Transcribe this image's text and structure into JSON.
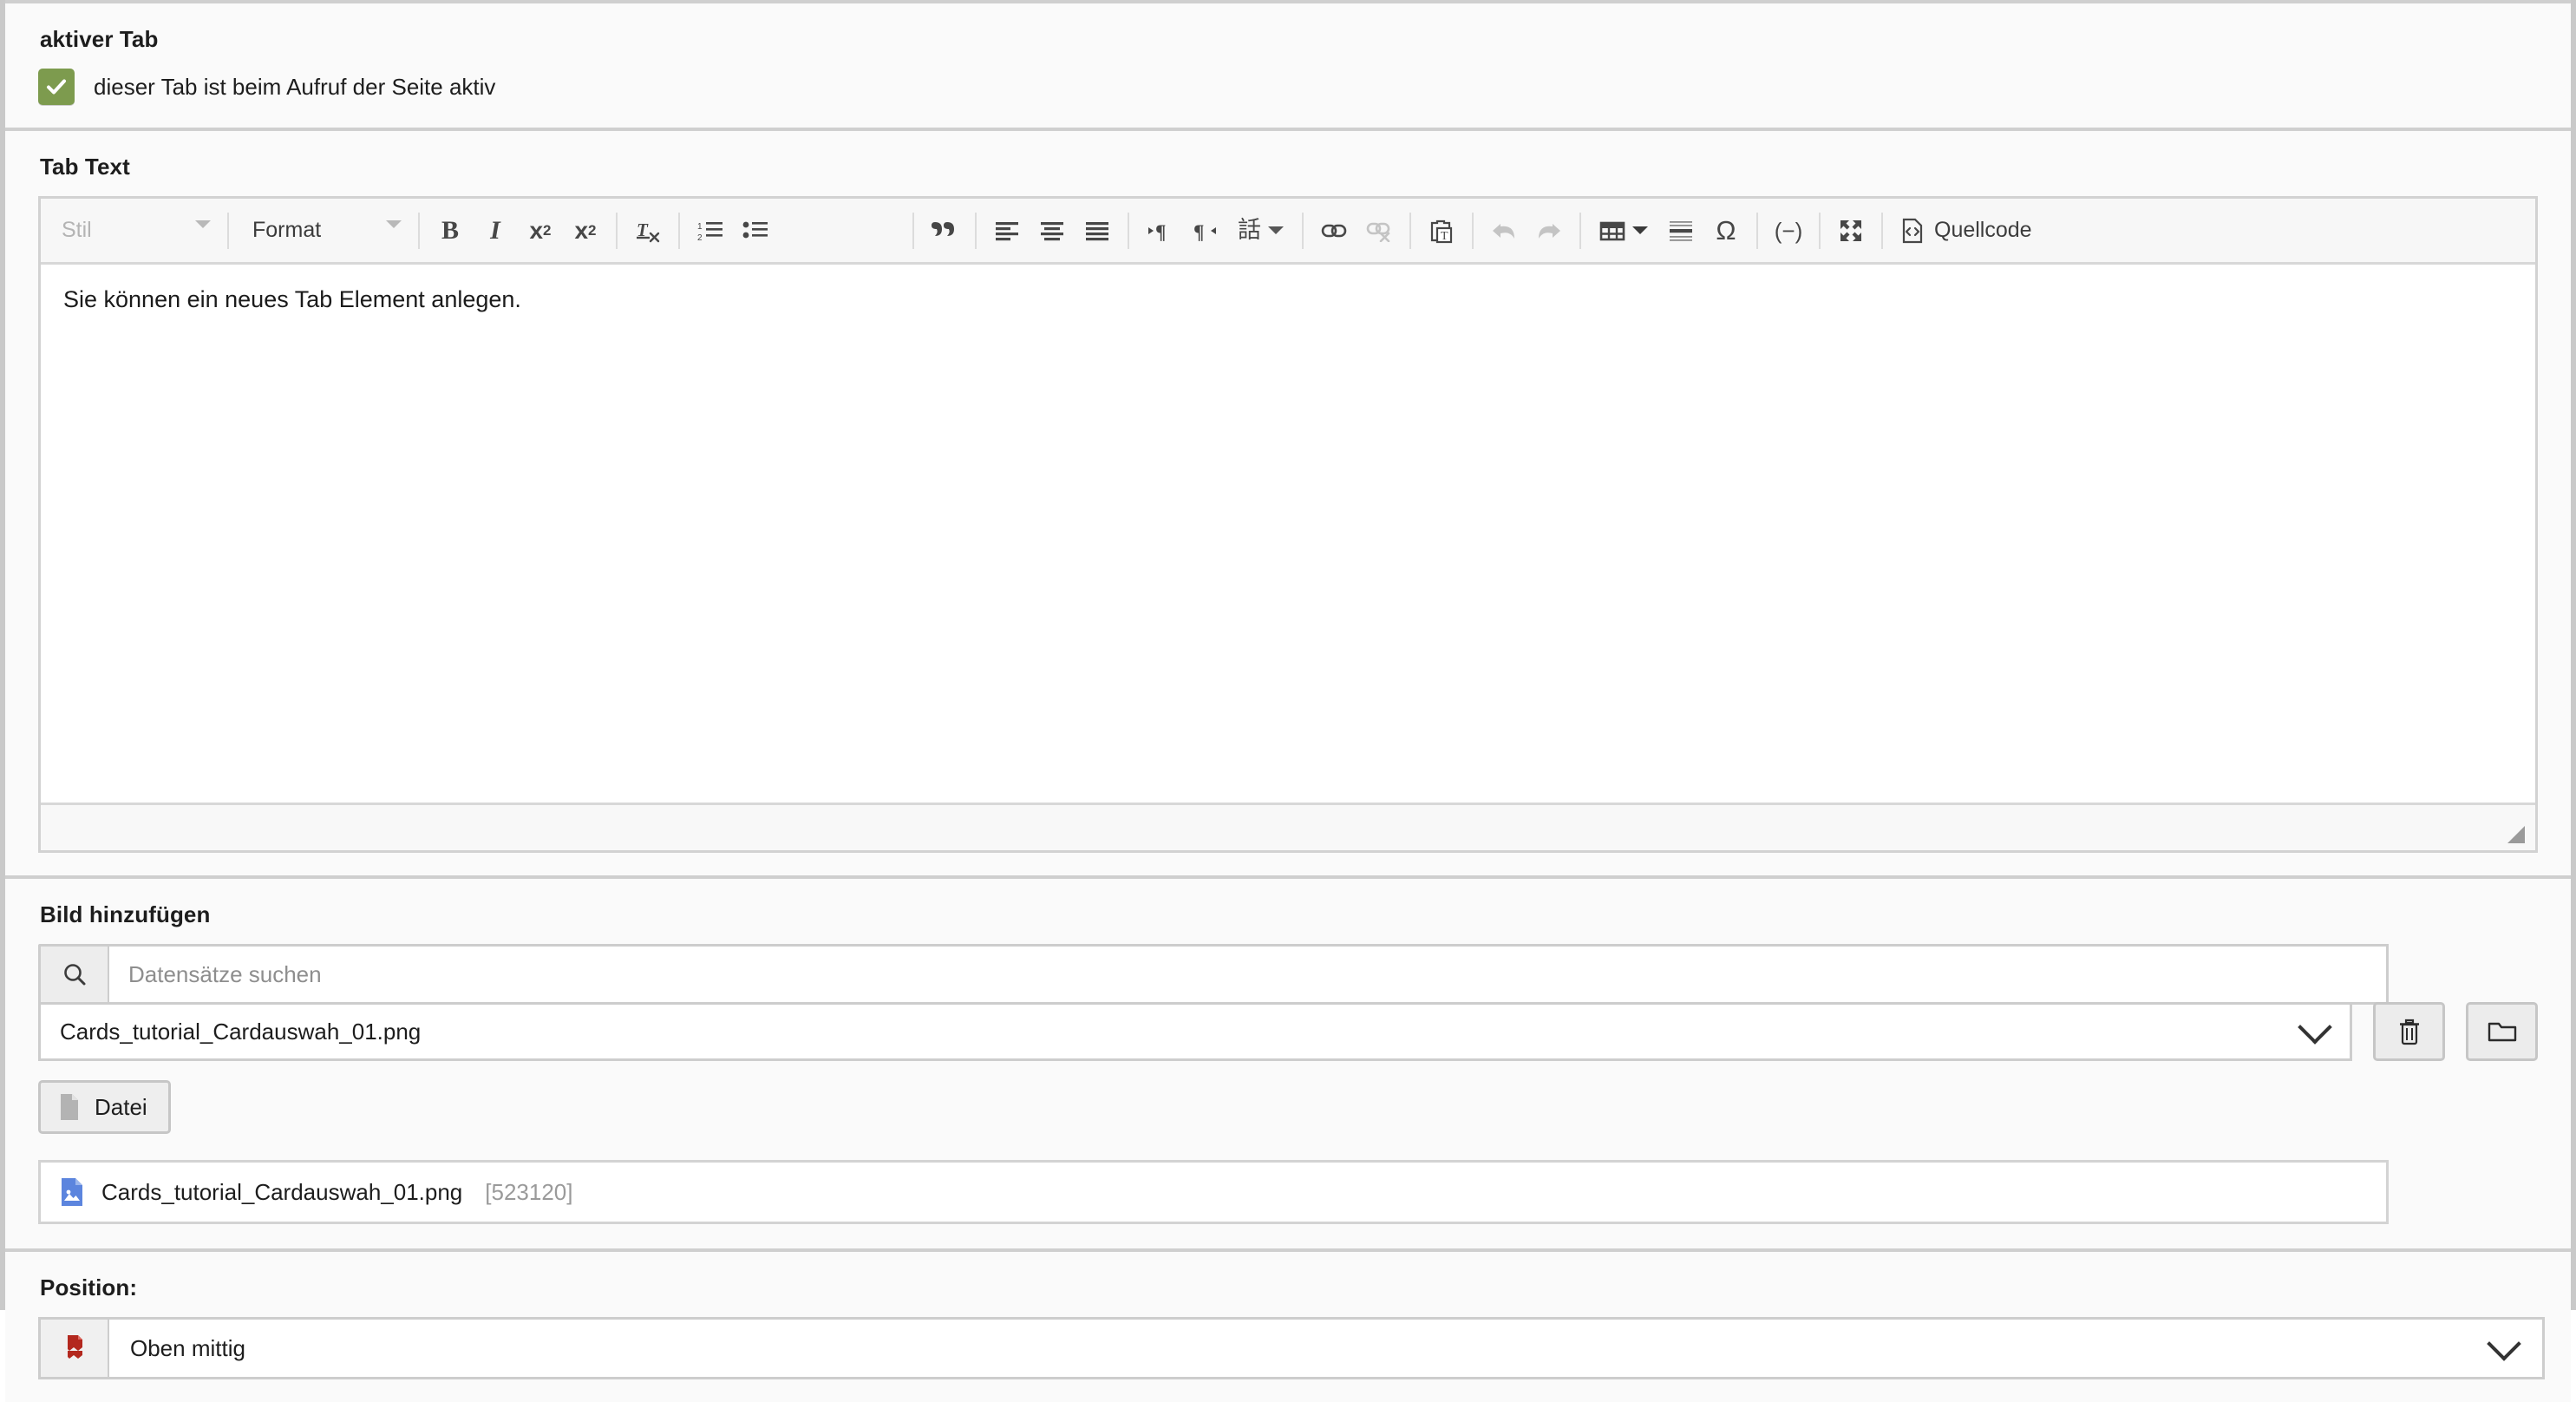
{
  "sections": {
    "active_tab": {
      "legend": "aktiver Tab",
      "checkbox_label": "dieser Tab ist beim Aufruf der Seite aktiv",
      "checkbox_checked": true,
      "checkbox_color": "#7d9b4e"
    },
    "tab_text": {
      "legend": "Tab Text",
      "content": "Sie können ein neues Tab Element anlegen."
    },
    "add_image": {
      "legend": "Bild hinzufügen",
      "search_placeholder": "Datensätze suchen",
      "search_value": "",
      "selected_record": "Cards_tutorial_Cardauswah_01.png",
      "delete_button_title": "Löschen",
      "browse_button_title": "Durchsuchen",
      "file_button_label": "Datei",
      "attached_file": {
        "name": "Cards_tutorial_Cardauswah_01.png",
        "size": "[523120]"
      }
    },
    "position": {
      "legend": "Position:",
      "selected": "Oben mittig"
    }
  },
  "editor": {
    "style_combo": "Stil",
    "format_combo": "Format",
    "source_label": "Quellcode",
    "buttons": [
      {
        "name": "bold-button",
        "title": "Fett"
      },
      {
        "name": "italic-button",
        "title": "Kursiv"
      },
      {
        "name": "subscript-button",
        "title": "Tiefgestellt"
      },
      {
        "name": "superscript-button",
        "title": "Hochgestellt"
      },
      {
        "name": "remove-format-button",
        "title": "Formatierung entfernen"
      },
      {
        "name": "numbered-list-button",
        "title": "Nummerierte Liste"
      },
      {
        "name": "bulleted-list-button",
        "title": "Liste"
      },
      {
        "name": "blockquote-button",
        "title": "Blockzitat"
      },
      {
        "name": "align-left-button",
        "title": "Linksbündig"
      },
      {
        "name": "align-center-button",
        "title": "Zentriert"
      },
      {
        "name": "justify-button",
        "title": "Blocksatz"
      },
      {
        "name": "text-direction-ltr-button",
        "title": "Textrichtung von links nach rechts"
      },
      {
        "name": "text-direction-rtl-button",
        "title": "Textrichtung von rechts nach links"
      },
      {
        "name": "language-button",
        "title": "Sprache"
      },
      {
        "name": "link-button",
        "title": "Link einfügen"
      },
      {
        "name": "unlink-button",
        "title": "Link entfernen",
        "disabled": true
      },
      {
        "name": "paste-as-text-button",
        "title": "Als Text einfügen"
      },
      {
        "name": "undo-button",
        "title": "Rückgängig",
        "disabled": true
      },
      {
        "name": "redo-button",
        "title": "Wiederherstellen",
        "disabled": true
      },
      {
        "name": "table-button",
        "title": "Tabelle"
      },
      {
        "name": "horizontal-rule-button",
        "title": "Horizontale Linie"
      },
      {
        "name": "special-character-button",
        "title": "Sonderzeichen"
      },
      {
        "name": "soft-hyphen-button",
        "title": "Weiches Trennzeichen"
      },
      {
        "name": "maximize-button",
        "title": "Maximieren"
      },
      {
        "name": "source-button",
        "title": "Quellcode"
      }
    ]
  }
}
